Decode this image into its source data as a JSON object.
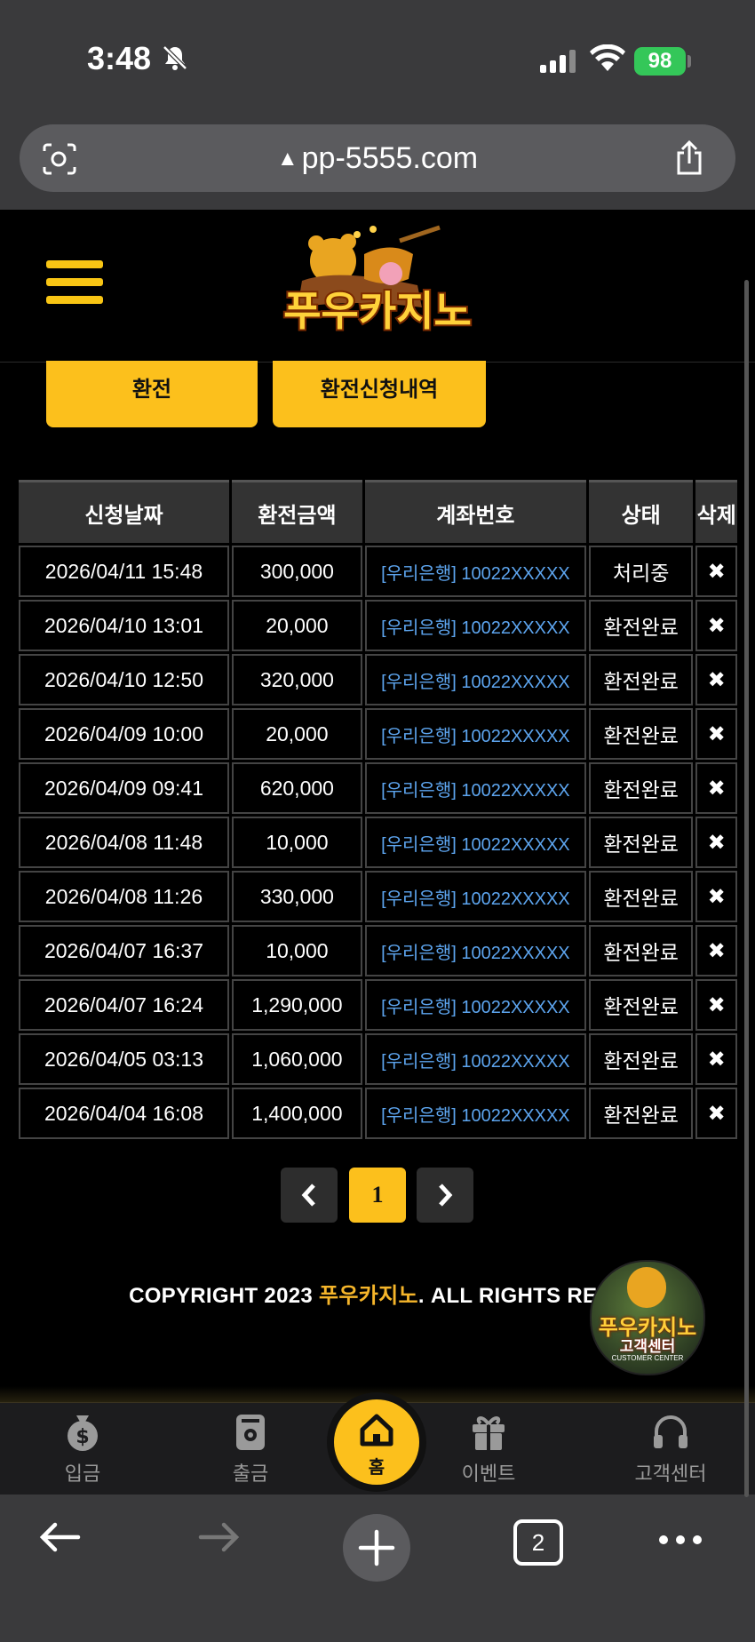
{
  "status_bar": {
    "time": "3:48",
    "battery": "98"
  },
  "browser": {
    "url": "pp-5555.com",
    "tab_count": "2"
  },
  "site": {
    "logo_text": "푸우카지노",
    "buttons": {
      "exchange": "환전",
      "history": "환전신청내역"
    }
  },
  "table": {
    "headers": [
      "신청날짜",
      "환전금액",
      "계좌번호",
      "상태",
      "삭제"
    ],
    "rows": [
      {
        "date": "2026/04/11 15:48",
        "amount": "300,000",
        "account": "[우리은행] 10022XXXXX",
        "status": "처리중"
      },
      {
        "date": "2026/04/10 13:01",
        "amount": "20,000",
        "account": "[우리은행] 10022XXXXX",
        "status": "환전완료"
      },
      {
        "date": "2026/04/10 12:50",
        "amount": "320,000",
        "account": "[우리은행] 10022XXXXX",
        "status": "환전완료"
      },
      {
        "date": "2026/04/09 10:00",
        "amount": "20,000",
        "account": "[우리은행] 10022XXXXX",
        "status": "환전완료"
      },
      {
        "date": "2026/04/09 09:41",
        "amount": "620,000",
        "account": "[우리은행] 10022XXXXX",
        "status": "환전완료"
      },
      {
        "date": "2026/04/08 11:48",
        "amount": "10,000",
        "account": "[우리은행] 10022XXXXX",
        "status": "환전완료"
      },
      {
        "date": "2026/04/08 11:26",
        "amount": "330,000",
        "account": "[우리은행] 10022XXXXX",
        "status": "환전완료"
      },
      {
        "date": "2026/04/07 16:37",
        "amount": "10,000",
        "account": "[우리은행] 10022XXXXX",
        "status": "환전완료"
      },
      {
        "date": "2026/04/07 16:24",
        "amount": "1,290,000",
        "account": "[우리은행] 10022XXXXX",
        "status": "환전완료"
      },
      {
        "date": "2026/04/05 03:13",
        "amount": "1,060,000",
        "account": "[우리은행] 10022XXXXX",
        "status": "환전완료"
      },
      {
        "date": "2026/04/04 16:08",
        "amount": "1,400,000",
        "account": "[우리은행] 10022XXXXX",
        "status": "환전완료"
      }
    ],
    "delete_glyph": "✖"
  },
  "pagination": {
    "prev": "‹",
    "current": "1",
    "next": "›"
  },
  "footer": {
    "copyright_prefix": "COPYRIGHT 2023 ",
    "copyright_brand": "푸우카지노",
    "copyright_suffix": ". ALL RIGHTS RESE"
  },
  "cs_badge": {
    "title": "푸우카지노",
    "subtitle": "고객센터",
    "caption": "CUSTOMER CENTER"
  },
  "bottom_nav": {
    "deposit": "입금",
    "withdraw": "출금",
    "home": "홈",
    "event": "이벤트",
    "support": "고객센터"
  },
  "colors": {
    "accent": "#fcc01c",
    "link": "#5da5ef",
    "background": "#000000"
  }
}
